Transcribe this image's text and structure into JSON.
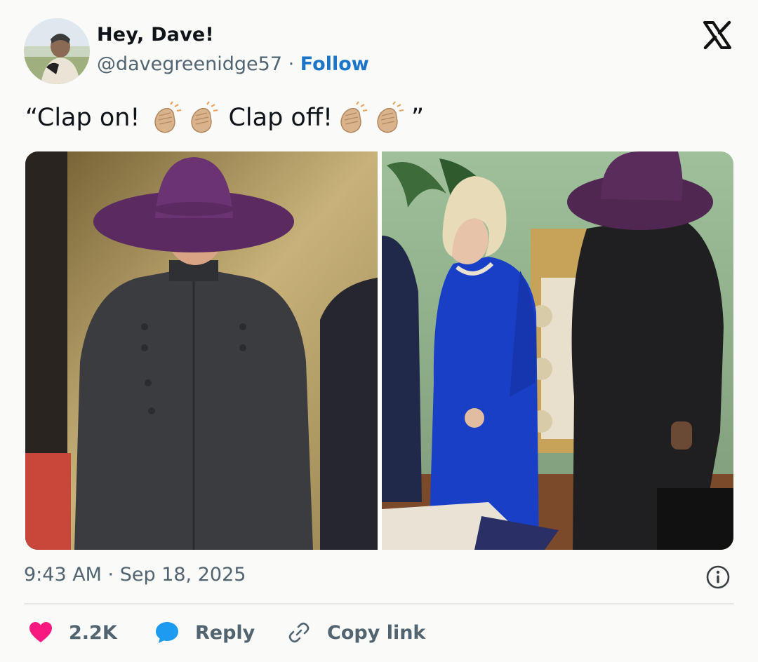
{
  "user": {
    "display_name": "Hey, Dave!",
    "handle": "@davegreenidge57",
    "separator": "·",
    "follow_label": "Follow"
  },
  "tweet": {
    "text_part1": "“Clap on!",
    "text_part2": "Clap off!",
    "text_end": "”",
    "emoji_name": "clapping-hands-light-skin"
  },
  "media": {
    "left_image": "woman-in-purple-wide-brim-hat-and-dark-suit",
    "right_image": "woman-in-royal-blue-dress-beside-woman-in-purple-hat"
  },
  "meta": {
    "timestamp": "9:43 AM · Sep 18, 2025"
  },
  "actions": {
    "likes": "2.2K",
    "reply_label": "Reply",
    "copy_label": "Copy link"
  },
  "colors": {
    "follow": "#1d75c9",
    "like_heart": "#f91880",
    "reply_bubble": "#1d9bf0",
    "muted_text": "#536471"
  }
}
